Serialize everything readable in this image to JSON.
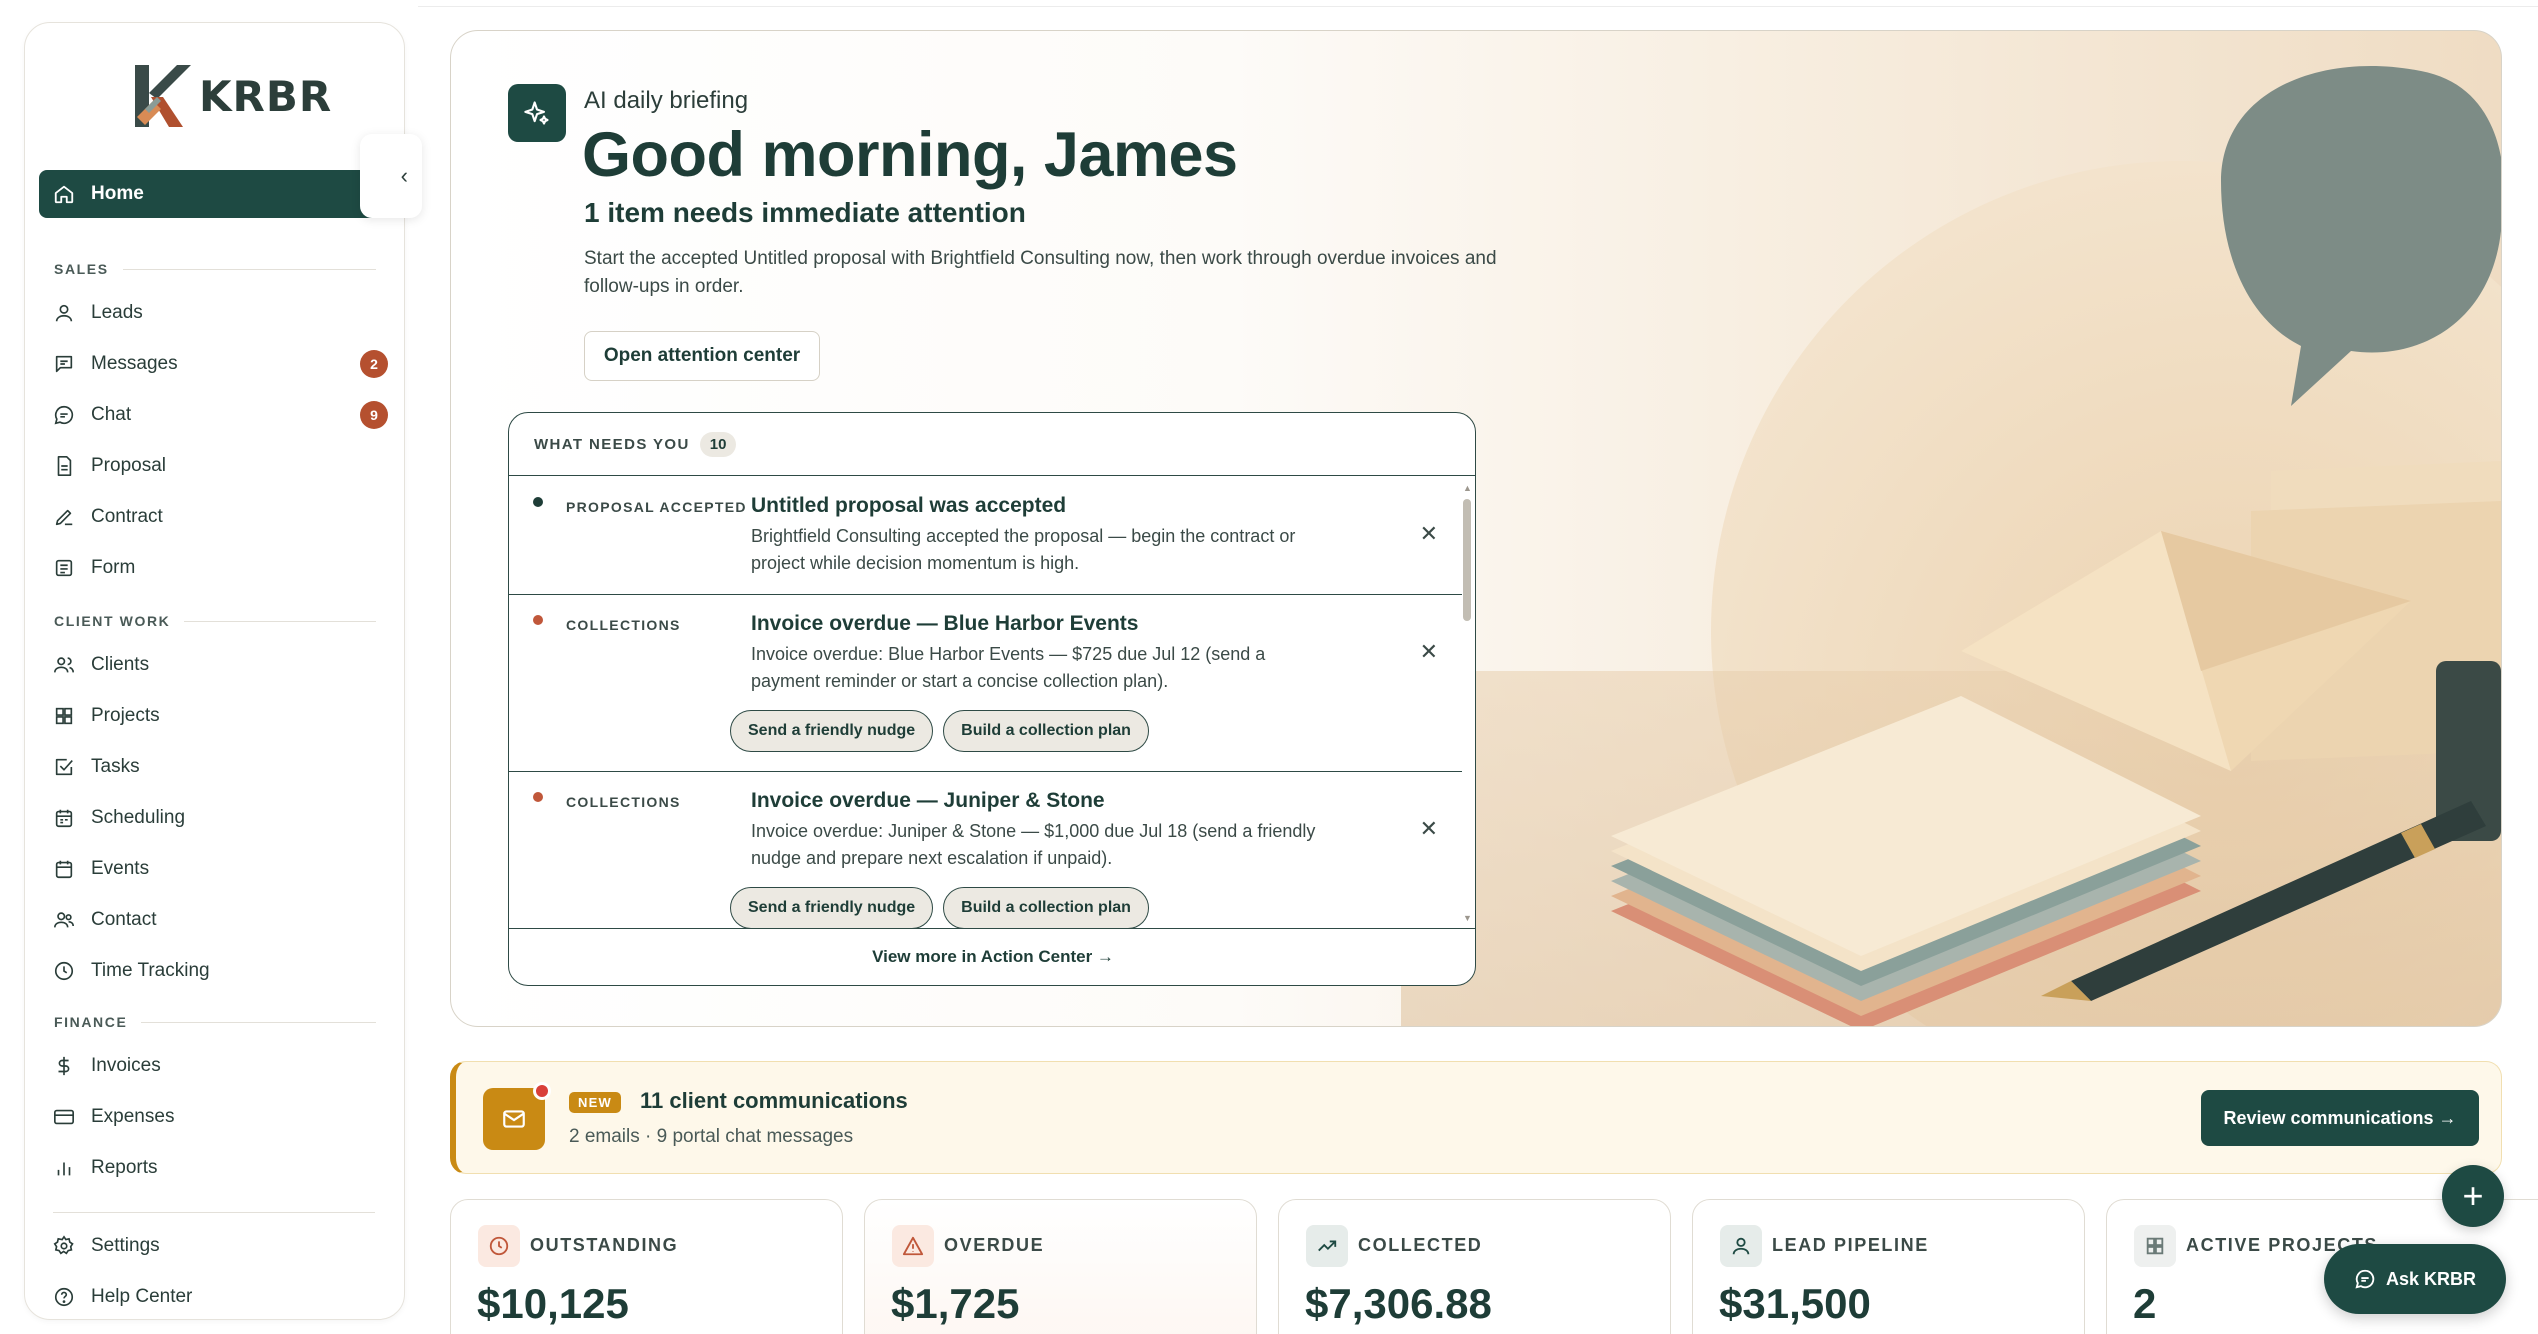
{
  "brand": {
    "name": "KRBR"
  },
  "sidebar": {
    "home": "Home",
    "sections": {
      "sales": "SALES",
      "client_work": "CLIENT WORK",
      "finance": "FINANCE"
    },
    "items": {
      "leads": "Leads",
      "messages": "Messages",
      "messages_badge": "2",
      "chat": "Chat",
      "chat_badge": "9",
      "proposal": "Proposal",
      "contract": "Contract",
      "form": "Form",
      "clients": "Clients",
      "projects": "Projects",
      "tasks": "Tasks",
      "scheduling": "Scheduling",
      "events": "Events",
      "contact": "Contact",
      "time_tracking": "Time Tracking",
      "invoices": "Invoices",
      "expenses": "Expenses",
      "reports": "Reports",
      "settings": "Settings",
      "help_center": "Help Center"
    }
  },
  "hero": {
    "eyebrow": "AI daily briefing",
    "greeting": "Good morning, James",
    "attention_title": "1 item needs immediate attention",
    "attention_desc": "Start the accepted Untitled proposal with Brightfield Consulting now, then work through overdue invoices and follow-ups in order.",
    "attention_button": "Open attention center"
  },
  "needs": {
    "heading": "WHAT NEEDS YOU",
    "count": "10",
    "items": [
      {
        "category": "PROPOSAL ACCEPTED",
        "title": "Untitled proposal was accepted",
        "desc": "Brightfield Consulting accepted the proposal — begin the contract or project while decision momentum is high.",
        "dot_color": "#1e3d37"
      },
      {
        "category": "COLLECTIONS",
        "title": "Invoice overdue — Blue Harbor Events",
        "desc": "Invoice overdue: Blue Harbor Events — $725 due Jul 12 (send a payment reminder or start a concise collection plan).",
        "dot_color": "#c0573a",
        "actions": [
          "Send a friendly nudge",
          "Build a collection plan"
        ]
      },
      {
        "category": "COLLECTIONS",
        "title": "Invoice overdue — Juniper & Stone",
        "desc": "Invoice overdue: Juniper & Stone — $1,000 due Jul 18 (send a friendly nudge and prepare next escalation if unpaid).",
        "dot_color": "#c0573a",
        "actions": [
          "Send a friendly nudge",
          "Build a collection plan"
        ]
      }
    ],
    "footer": "View more in Action Center  →"
  },
  "communications": {
    "tag": "NEW",
    "title": "11 client communications",
    "subtitle": "2 emails · 9 portal chat messages",
    "button": "Review communications  →"
  },
  "stats": [
    {
      "label": "OUTSTANDING",
      "value": "$10,125",
      "icon": "clock-icon",
      "color": "#c0573a"
    },
    {
      "label": "OVERDUE",
      "value": "$1,725",
      "icon": "alert-triangle-icon",
      "color": "#c0573a"
    },
    {
      "label": "COLLECTED",
      "value": "$7,306.88",
      "icon": "trending-up-icon",
      "color": "#1e4a43"
    },
    {
      "label": "LEAD PIPELINE",
      "value": "$31,500",
      "icon": "user-icon",
      "color": "#1e4a43"
    },
    {
      "label": "ACTIVE PROJECTS",
      "value": "2",
      "icon": "grid-icon",
      "color": "#1e4a43"
    }
  ],
  "fab": {
    "plus": "+",
    "ask": "Ask KRBR"
  },
  "colors": {
    "primary": "#1e4a43",
    "accent_orange": "#c0573a",
    "amber": "#c98a14",
    "badge": "#b5502f"
  }
}
